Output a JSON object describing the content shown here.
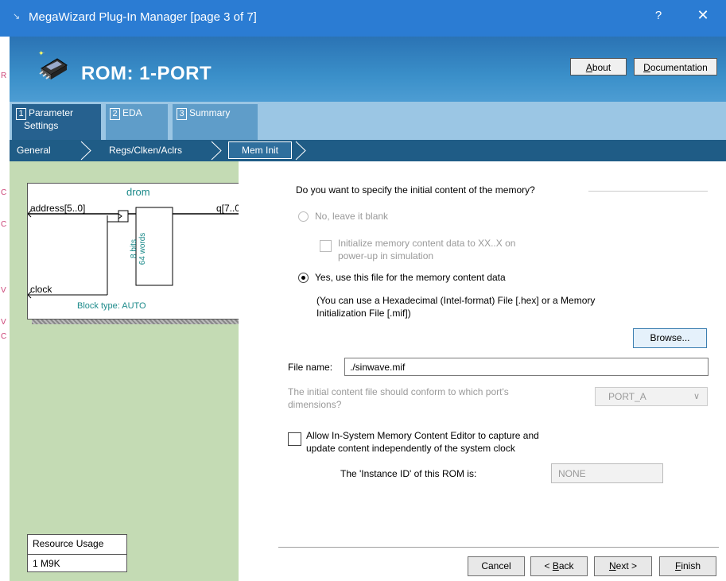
{
  "window": {
    "title": "MegaWizard Plug-In Manager [page 3 of 7]",
    "help_label": "?",
    "close_label": "✕"
  },
  "header": {
    "title": "ROM: 1-PORT",
    "about_label": "About",
    "documentation_label": "Documentation"
  },
  "tabs": [
    {
      "num": "1",
      "label_line1": "Parameter",
      "label_line2": "Settings"
    },
    {
      "num": "2",
      "label_line1": "EDA"
    },
    {
      "num": "3",
      "label_line1": "Summary"
    }
  ],
  "breadcrumb": [
    "General",
    "Regs/Clken/Aclrs",
    "Mem Init"
  ],
  "symbol": {
    "name": "drom",
    "port_address": "address[5..0]",
    "port_q": "q[7..0]",
    "port_clock": "clock",
    "bits_label": "8 bits",
    "words_label": "64 words",
    "block_type": "Block type: AUTO"
  },
  "resource": {
    "heading": "Resource Usage",
    "value": "1 M9K"
  },
  "meminit": {
    "question": "Do you want to specify the initial content of the memory?",
    "option_blank": "No, leave it blank",
    "init_line1": "Initialize memory content data to XX..X on",
    "init_line2": "power-up in simulation",
    "option_file": "Yes, use this file for the memory content data",
    "hint_line1": "(You can use a Hexadecimal (Intel-format) File [.hex] or a Memory",
    "hint_line2": "Initialization File [.mif])",
    "browse_label": "Browse...",
    "filename_label": "File name:",
    "filename_value": "./sinwave.mif",
    "conform_line1": "The initial content file should conform to which port's",
    "conform_line2": "dimensions?",
    "port_value": "PORT_A",
    "insys_line1": "Allow In-System Memory Content Editor to capture and",
    "insys_line2": "update content independently of the system clock",
    "instance_label": "The 'Instance ID' of this ROM is:",
    "instance_value": "NONE",
    "selected_option": "file"
  },
  "footer": {
    "cancel_label": "Cancel",
    "back_label": "< Back",
    "next_label": "Next >",
    "finish_label": "Finish"
  },
  "colors": {
    "titlebar": "#2b7cd3",
    "header": "#3a8fc9",
    "breadcrumb": "#1f5c86",
    "left_pane": "#c4dbb4"
  }
}
